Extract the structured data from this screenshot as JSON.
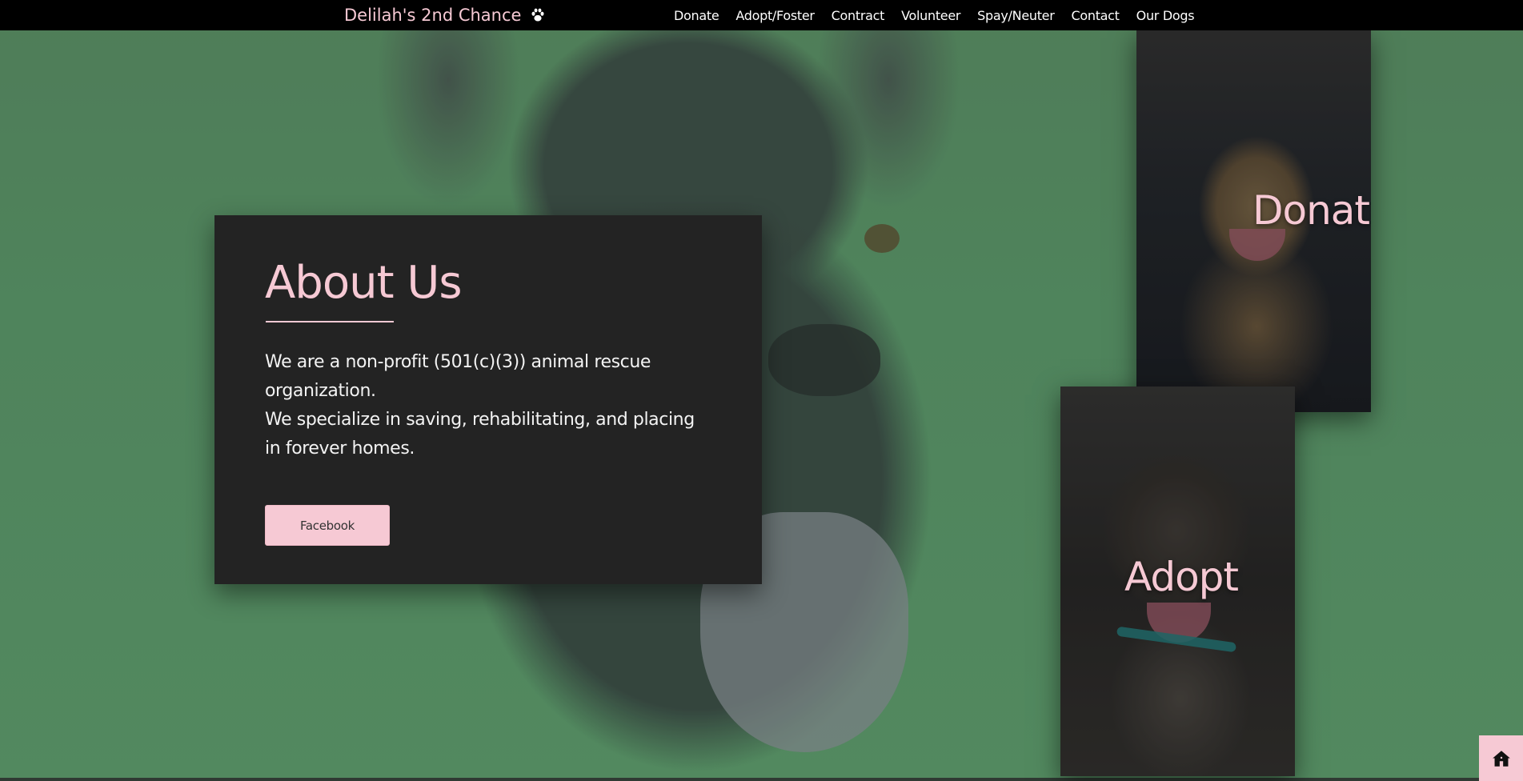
{
  "navbar": {
    "brand": "Delilah's 2nd Chance",
    "brand_icon": "paw-icon",
    "links": [
      {
        "label": "Donate"
      },
      {
        "label": "Adopt/Foster"
      },
      {
        "label": "Contract"
      },
      {
        "label": "Volunteer"
      },
      {
        "label": "Spay/Neuter"
      },
      {
        "label": "Contact"
      },
      {
        "label": "Our Dogs"
      }
    ]
  },
  "about": {
    "title": "About Us",
    "lines": [
      "We are a non-profit (501(c)(3)) animal rescue organization.",
      "We specialize in saving, rehabilitating, and placing in forever homes."
    ],
    "facebook_label": "Facebook"
  },
  "tiles": {
    "donate_label": "Donate",
    "adopt_label": "Adopt"
  },
  "home_button": {
    "icon": "home-icon"
  },
  "colors": {
    "accent_pink": "#f6c9d4",
    "card_bg": "#232323",
    "navbar_bg": "#000000"
  }
}
